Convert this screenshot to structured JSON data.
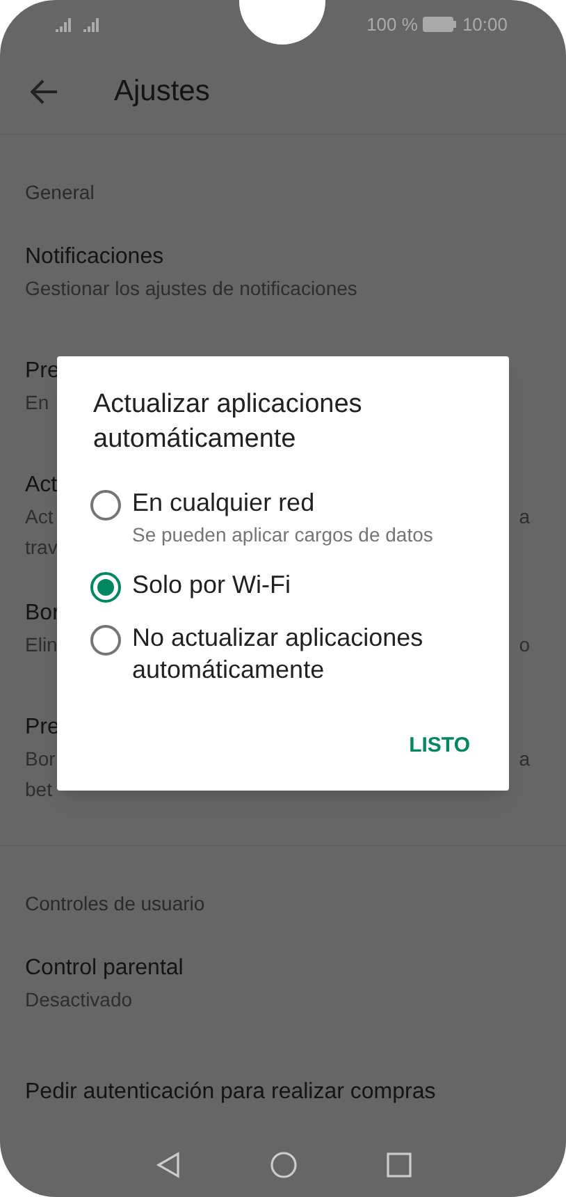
{
  "status_bar": {
    "battery_text": "100 %",
    "time": "10:00"
  },
  "header": {
    "title": "Ajustes"
  },
  "sections": [
    {
      "heading": "General",
      "items": [
        {
          "title": "Notificaciones",
          "lines": [
            {
              "text": "Gestionar los ajustes de notificaciones"
            }
          ]
        },
        {
          "title": "Pre",
          "lines": [
            {
              "text": "En"
            }
          ]
        },
        {
          "title": "Act",
          "lines": [
            {
              "text": "Act",
              "end": "a"
            },
            {
              "text": "trav"
            }
          ]
        },
        {
          "title": "Bor",
          "lines": [
            {
              "text": "Elin",
              "end": "o"
            }
          ]
        },
        {
          "title": "Pre",
          "lines": [
            {
              "text": "Bor",
              "end": "a"
            },
            {
              "text": "bet"
            }
          ]
        }
      ]
    },
    {
      "heading": "Controles de usuario",
      "items": [
        {
          "title": "Control parental",
          "lines": [
            {
              "text": "Desactivado"
            }
          ]
        },
        {
          "title": "Pedir autenticación para realizar compras"
        }
      ]
    }
  ],
  "dialog": {
    "title": "Actualizar aplicaciones automáticamente",
    "options": [
      {
        "label": "En cualquier red",
        "subtitle": "Se pueden aplicar cargos de datos",
        "selected": false
      },
      {
        "label": "Solo por Wi-Fi",
        "selected": true
      },
      {
        "label": "No actualizar aplicaciones automáticamente",
        "selected": false
      }
    ],
    "button": "LISTO"
  }
}
